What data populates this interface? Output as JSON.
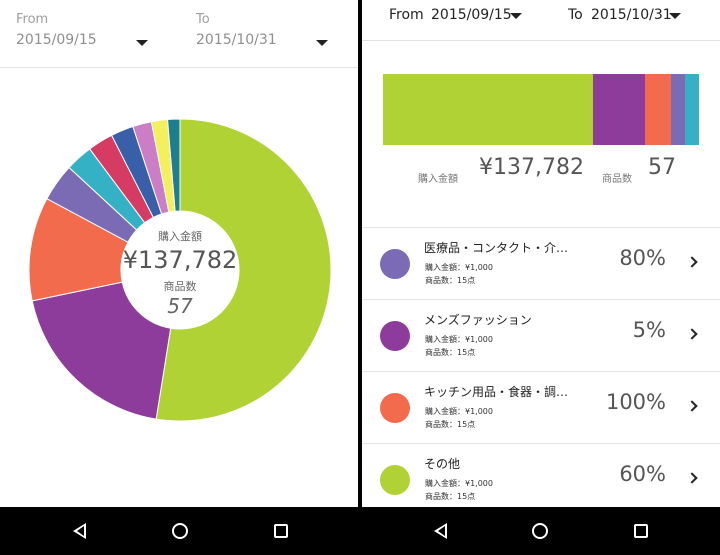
{
  "left": {
    "from_label": "From",
    "from_date": "2015/09/15",
    "to_label": "To",
    "to_date": "2015/10/31",
    "center": {
      "amount_label": "購入金額",
      "amount_value": "¥137,782",
      "count_label": "商品数",
      "count_value": "57"
    }
  },
  "right": {
    "from_label": "From",
    "from_date": "2015/09/15",
    "to_label": "To",
    "to_date": "2015/10/31",
    "summary": {
      "amount_label": "購入金額",
      "amount_value": "¥137,782",
      "count_label": "商品数",
      "count_value": "57"
    },
    "categories": [
      {
        "name": "医療品・コンタクト・介…",
        "amount": "購入金額：¥1,000",
        "count": "商品数：15点",
        "percent": "80%",
        "color": "#7b6bb5"
      },
      {
        "name": "メンズファッション",
        "amount": "購入金額：¥1,000",
        "count": "商品数：15点",
        "percent": "5%",
        "color": "#8e3c9c"
      },
      {
        "name": "キッチン用品・食器・調…",
        "amount": "購入金額：¥1,000",
        "count": "商品数：15点",
        "percent": "100%",
        "color": "#f26b4d"
      },
      {
        "name": "その他",
        "amount": "購入金額：¥1,000",
        "count": "商品数：15点",
        "percent": "60%",
        "color": "#b1d234"
      }
    ]
  },
  "chart_data": [
    {
      "type": "pie",
      "donut": true,
      "colors": [
        "#b1d234",
        "#8e3c9c",
        "#f26b4d",
        "#7b6bb5",
        "#35b1c6",
        "#d63b63",
        "#3a5fa9",
        "#cb7ec6",
        "#f3ef5d",
        "#1c7f8f"
      ],
      "values": [
        52.0,
        19.0,
        11.0,
        4.0,
        2.9,
        2.7,
        2.4,
        2.0,
        1.7,
        1.3
      ]
    },
    {
      "type": "bar",
      "stacked": true,
      "orientation": "horizontal",
      "colors": [
        "#b1d234",
        "#8e3c9c",
        "#f26b4d",
        "#7b6bb5",
        "#35b1c6"
      ],
      "values": [
        66.5,
        16.5,
        8.2,
        4.4,
        4.4
      ]
    }
  ],
  "nav": {
    "icons": [
      "back-icon",
      "home-icon",
      "recent-apps-icon"
    ]
  }
}
